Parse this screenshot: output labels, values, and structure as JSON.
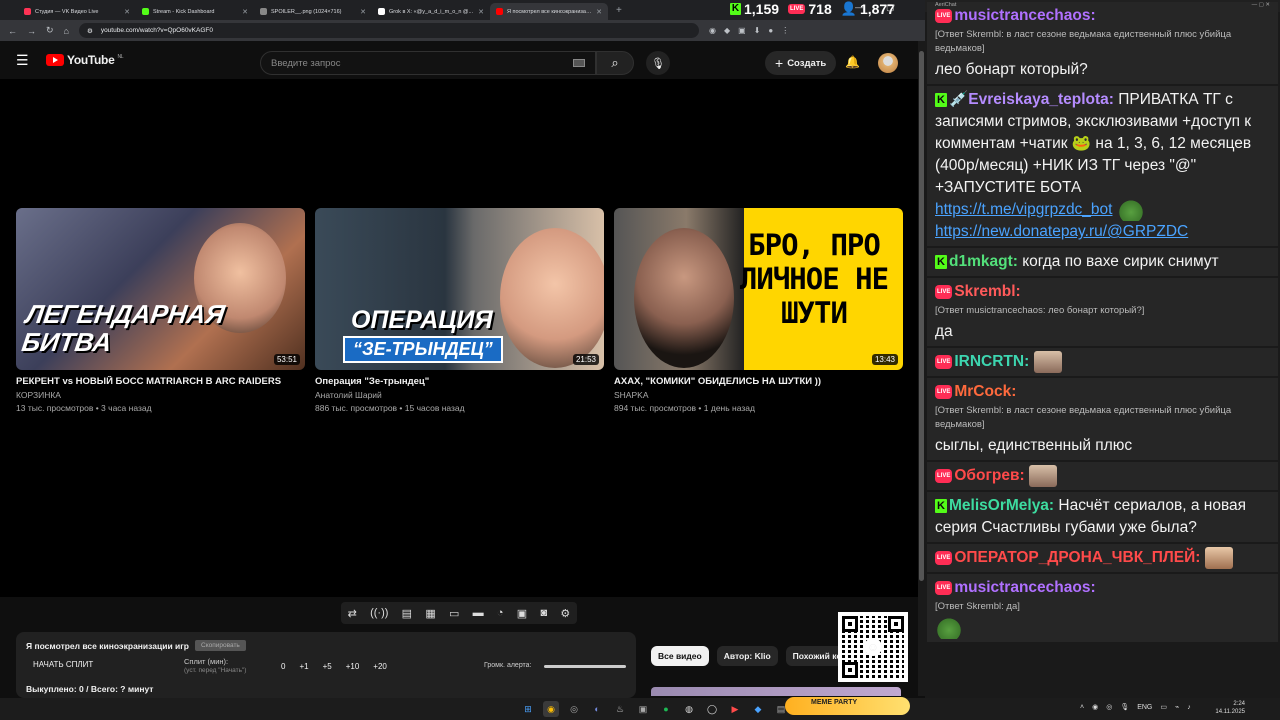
{
  "browser": {
    "tabs": [
      {
        "title": "Студия — VK Видео Live",
        "color": "#ff3355",
        "active": false
      },
      {
        "title": "Stream - Kick Dashboard",
        "color": "#53fc18",
        "active": false
      },
      {
        "title": "SPOILER__.png (1024×716)",
        "color": "#888888",
        "active": false
      },
      {
        "title": "Grok в X: «@y_a_d_i_m_o_n @...",
        "color": "#ffffff",
        "active": false
      },
      {
        "title": "Я посмотрел все киноэкранизации...",
        "color": "#ff0000",
        "active": true
      }
    ],
    "new_tab": "+",
    "url": "youtube.com/watch?v=QpO60vKAGF0"
  },
  "counters": {
    "kick": "1,159",
    "vk": "718",
    "viewers": "1,877",
    "kick_icon": "K",
    "vk_icon": "LIVE",
    "viewers_icon": "👤"
  },
  "youtube": {
    "logo": "YouTube",
    "region": "NL",
    "search_placeholder": "Введите запрос",
    "create": "Создать",
    "endcards": [
      {
        "title": "РЕКРЕНТ vs НОВЫЙ БОСС MATRIARCH В ARC RAIDERS",
        "channel": "КОРЗИНКА",
        "meta": "13 тыс. просмотров • 3 часа назад",
        "duration": "53:51",
        "overlay": "ЛЕГЕНДАРНАЯ БИТВА",
        "overlay2": ""
      },
      {
        "title": "Операция \"Зе-трындец\"",
        "channel": "Анатолий Шарий",
        "meta": "886 тыс. просмотров • 15 часов назад",
        "duration": "21:53",
        "overlay": "ОПЕРАЦИЯ",
        "overlay2": "“ЗЕ-ТРЫНДЕЦ”"
      },
      {
        "title": "АХАХ, \"КОМИКИ\" ОБИДЕЛИСЬ НА ШУТКИ ))",
        "channel": "SHAPKA",
        "meta": "894 тыс. просмотров • 1 день назад",
        "duration": "13:43",
        "overlay": "БРО, ПРО ЛИЧНОЕ НЕ ШУТИ",
        "overlay2": ""
      }
    ],
    "widget": {
      "title": "Я посмотрел все киноэкранизации игр",
      "tag": "Скопировать",
      "start": "НАЧАТЬ СПЛИТ",
      "split_label": "Сплит (мин):",
      "split_hint": "(уст. перед \"Начать\")",
      "values": [
        "0",
        "+1",
        "+5",
        "+10",
        "+20"
      ],
      "alert": "Громк. алерта:",
      "bought": "Выкуплено: 0 / Всего: ? минут"
    },
    "chips": [
      "Все видео",
      "Автор: Klio",
      "Похожий кон"
    ]
  },
  "chat": {
    "title": "AeriChat",
    "messages": [
      {
        "platform": "vk",
        "nick": "musictrancechaos:",
        "color": "#b070ff",
        "reply": "[Ответ Skrembl: в ласт сезоне ведьмака едиственный плюс убийца ведьмаков]",
        "text": "лео бонарт который?",
        "emote": ""
      },
      {
        "platform": "kick",
        "nick": "💉Evreiskaya_teplota:",
        "color": "#b58cff",
        "reply": "",
        "text": "ПРИВАТКА ТГ с записями стримов, эксклюзивами +доступ к комментам +чатик 🐸 на 1, 3, 6, 12 месяцев (400р/месяц) +НИК ИЗ ТГ через \"@\" +ЗАПУСТИТЕ БОТА",
        "link1": "https://t.me/vipgrpzdc_bot",
        "link2": "https://new.donatepay.ru/@GRPZDC",
        "emote": ""
      },
      {
        "platform": "kick",
        "nick": "d1mkagt:",
        "color": "#53e07a",
        "reply": "",
        "text": "когда по вахе сирик снимут",
        "emote": ""
      },
      {
        "platform": "vk",
        "nick": "Skrembl:",
        "color": "#ff5a5a",
        "reply": "[Ответ musictrancechaos: лео бонарт который?]",
        "text": "да",
        "emote": ""
      },
      {
        "platform": "vk",
        "nick": "IRNCRTN:",
        "color": "#3dd6b0",
        "reply": "",
        "text": "",
        "emote": "face"
      },
      {
        "platform": "vk",
        "nick": "MrCock:",
        "color": "#ff6a3d",
        "reply": "[Ответ Skrembl: в ласт сезоне ведьмака едиственный плюс убийца ведьмаков]",
        "text": "сыглы, единственный плюс",
        "emote": ""
      },
      {
        "platform": "vk",
        "nick": "Обогрев:",
        "color": "#ff4a4a",
        "reply": "",
        "text": "",
        "emote": "face"
      },
      {
        "platform": "kick",
        "nick": "MelisOrMelya:",
        "color": "#3ddca0",
        "reply": "",
        "text": "Насчёт сериалов, а новая серия Счастливы губами уже была?",
        "emote": ""
      },
      {
        "platform": "vk",
        "nick": "ОПЕРАТОР_ДРОНА_ЧВК_ПЛЕЙ:",
        "color": "#ff4a4a",
        "reply": "",
        "text": "",
        "emote": "bald"
      },
      {
        "platform": "vk",
        "nick": "musictrancechaos:",
        "color": "#b070ff",
        "reply": "[Ответ Skrembl: да]",
        "text": "",
        "emote": "pepe"
      }
    ]
  },
  "taskbar": {
    "lang": "ENG",
    "time": "2:24",
    "date": "14.11.2025",
    "meme": "MEME PARTY"
  }
}
